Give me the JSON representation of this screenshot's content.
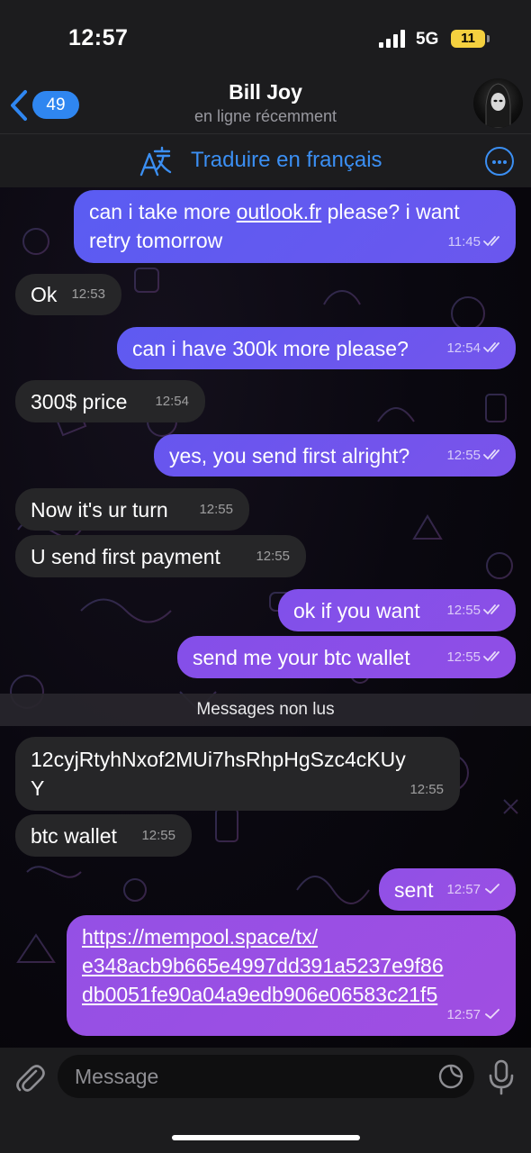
{
  "status_bar": {
    "time": "12:57",
    "network": "5G",
    "battery": "11"
  },
  "header": {
    "back_count": "49",
    "contact_name": "Bill Joy",
    "contact_status": "en ligne récemment"
  },
  "translate_bar": {
    "label": "Traduire en français"
  },
  "messages": [
    {
      "dir": "out",
      "parts": [
        "can i take more ",
        "outlook.fr",
        " please? i want",
        "retry tomorrow"
      ],
      "time": "11:45",
      "status": "read"
    },
    {
      "dir": "in",
      "text": "Ok",
      "time": "12:53"
    },
    {
      "dir": "out",
      "text": "can i have 300k more please?",
      "time": "12:54",
      "status": "read"
    },
    {
      "dir": "in",
      "text": "300$ price",
      "time": "12:54"
    },
    {
      "dir": "out",
      "text": "yes, you send first alright?",
      "time": "12:55",
      "status": "read"
    },
    {
      "dir": "in",
      "text": "Now it's ur turn",
      "time": "12:55"
    },
    {
      "dir": "in",
      "text": "U send first payment",
      "time": "12:55"
    },
    {
      "dir": "out",
      "text": "ok if you want",
      "time": "12:55",
      "status": "read"
    },
    {
      "dir": "out",
      "text": "send me your btc wallet",
      "time": "12:55",
      "status": "read"
    },
    {
      "dir": "in",
      "lines": [
        "12cyjRtyhNxof2MUi7hsRhpHgSzc4cKUy",
        "Y"
      ],
      "time": "12:55"
    },
    {
      "dir": "in",
      "text": "btc wallet",
      "time": "12:55"
    },
    {
      "dir": "out",
      "text": "sent",
      "time": "12:57",
      "status": "sent"
    },
    {
      "dir": "out",
      "lines": [
        "https://mempool.space/tx/",
        "e348acb9b665e4997dd391a5237e9f86",
        "db0051fe90a04a9edb906e06583c21f5"
      ],
      "time": "12:57",
      "status": "sent"
    }
  ],
  "unread_divider": "Messages non lus",
  "input": {
    "placeholder": "Message"
  },
  "colors": {
    "outgoing_top": "#5b5cf0",
    "outgoing_bottom": "#9b4fe0",
    "incoming": "#262628",
    "accent": "#3b8ff3"
  },
  "icons": [
    "back-chevron-icon",
    "signal-icon",
    "translate-icon",
    "more-icon",
    "read-receipt-icon",
    "sent-check-icon",
    "attach-icon",
    "sticker-icon",
    "mic-icon"
  ]
}
